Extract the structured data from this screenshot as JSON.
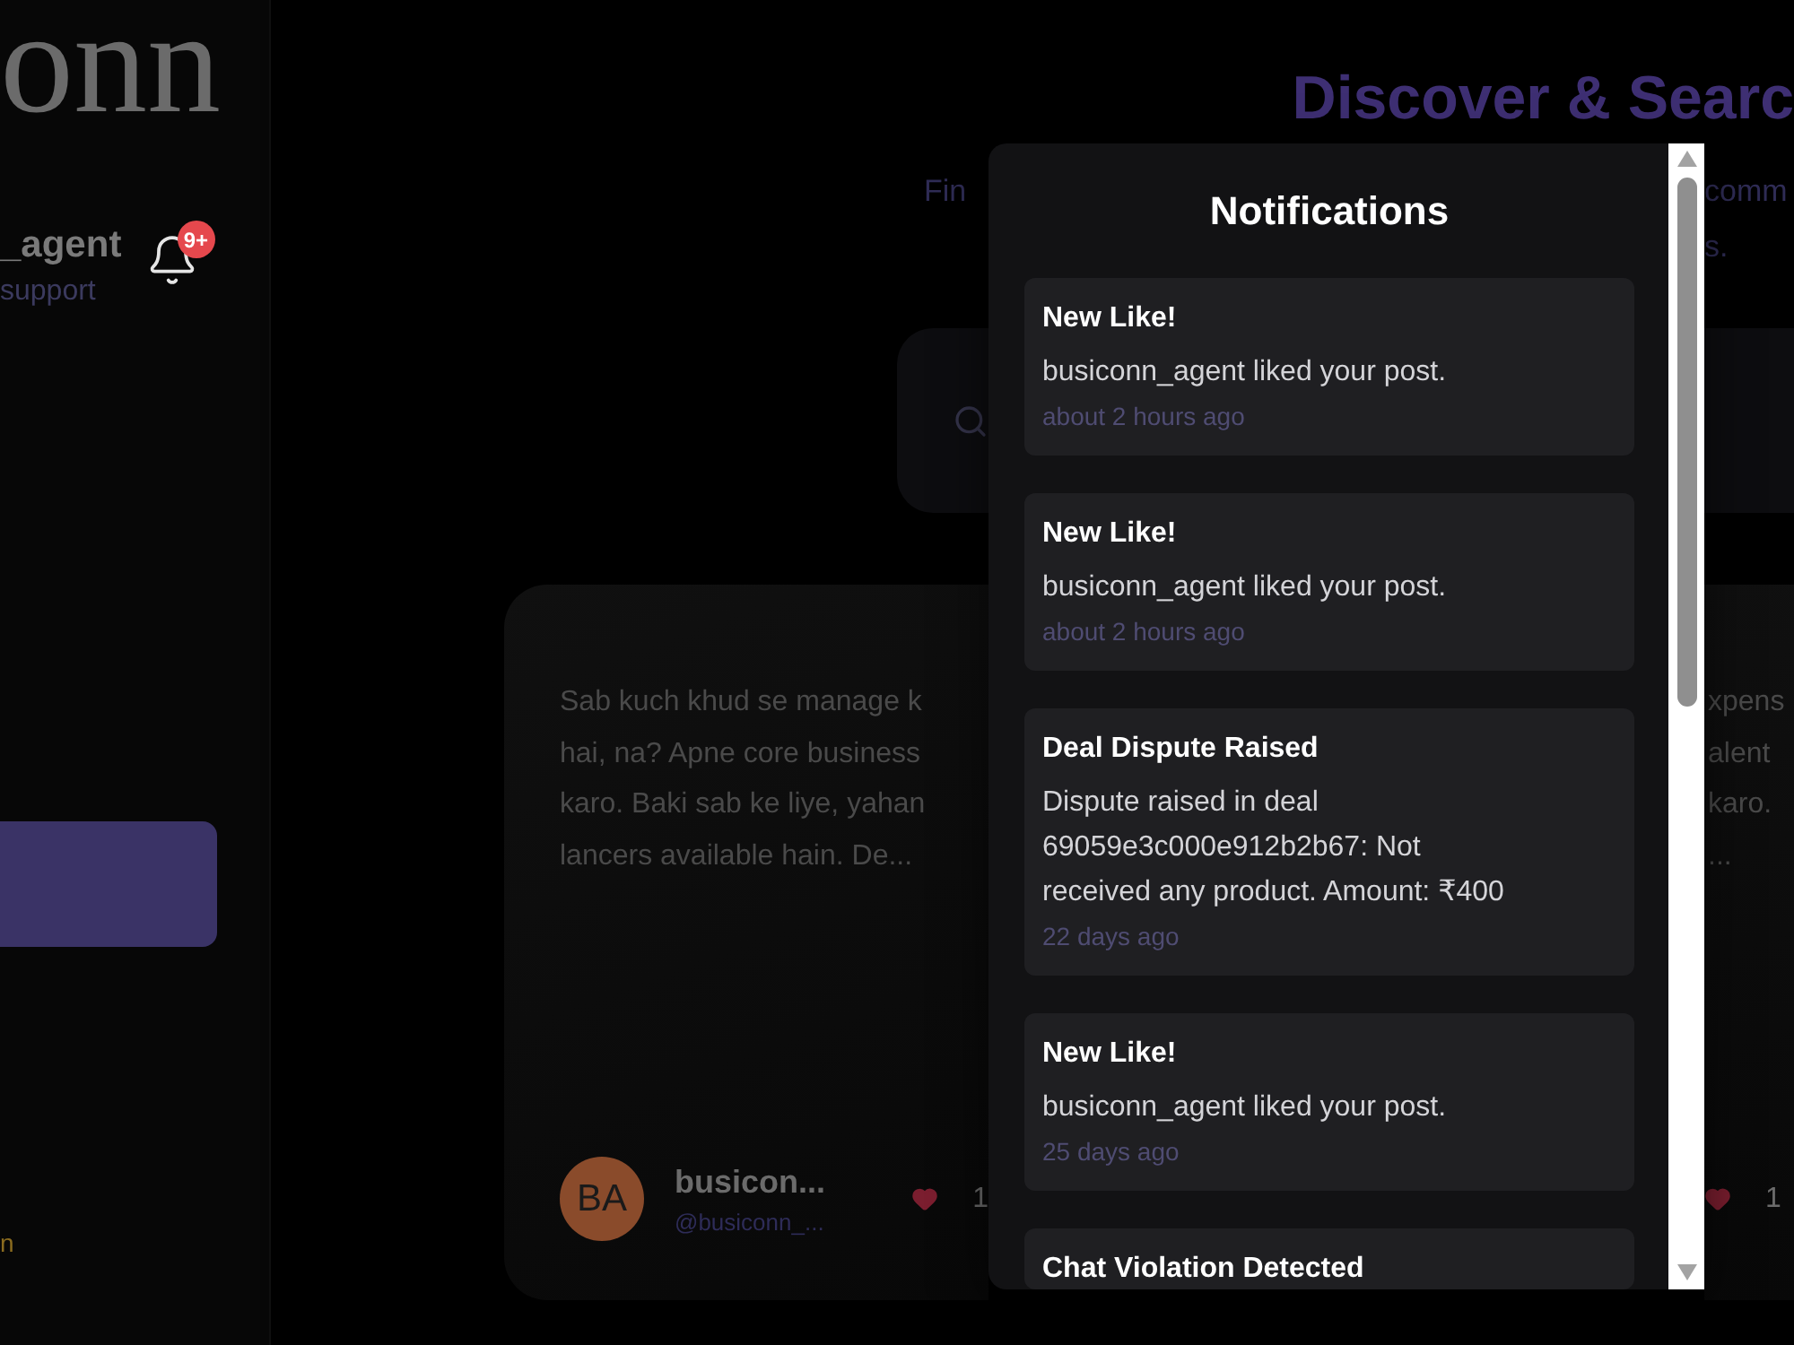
{
  "sidebar": {
    "logo": "onn",
    "user": {
      "name": "_agent",
      "role": "support"
    },
    "notification_badge": "9+",
    "footer_text": "n"
  },
  "header": {
    "title": "Discover & Searc",
    "subtitle_left": "Fin",
    "subtitle_right": [
      "comm",
      "s."
    ]
  },
  "posts": [
    {
      "excerpt_lines": [
        "Sab kuch khud se manage k",
        "hai, na? Apne core business",
        "karo. Baki sab ke liye, yahan",
        "lancers available hain. De..."
      ],
      "author": {
        "initials": "BA",
        "name": "busicon...",
        "handle": "@busiconn_..."
      },
      "liked": true,
      "likes": "1"
    },
    {
      "excerpt_lines": [
        "xpens",
        "alent",
        "karo.",
        "..."
      ],
      "liked": true,
      "likes": "1"
    }
  ],
  "notifications": {
    "title": "Notifications",
    "items": [
      {
        "title": "New Like!",
        "message": "busiconn_agent liked your post.",
        "time": "about 2 hours ago"
      },
      {
        "title": "New Like!",
        "message": "busiconn_agent liked your post.",
        "time": "about 2 hours ago"
      },
      {
        "title": "Deal Dispute Raised",
        "message": "Dispute raised in deal 69059e3c000e912b2b67: Not received any product. Amount: ₹400",
        "time": "22 days ago"
      },
      {
        "title": "New Like!",
        "message": "busiconn_agent liked your post.",
        "time": "25 days ago"
      },
      {
        "title": "Chat Violation Detected"
      }
    ]
  }
}
